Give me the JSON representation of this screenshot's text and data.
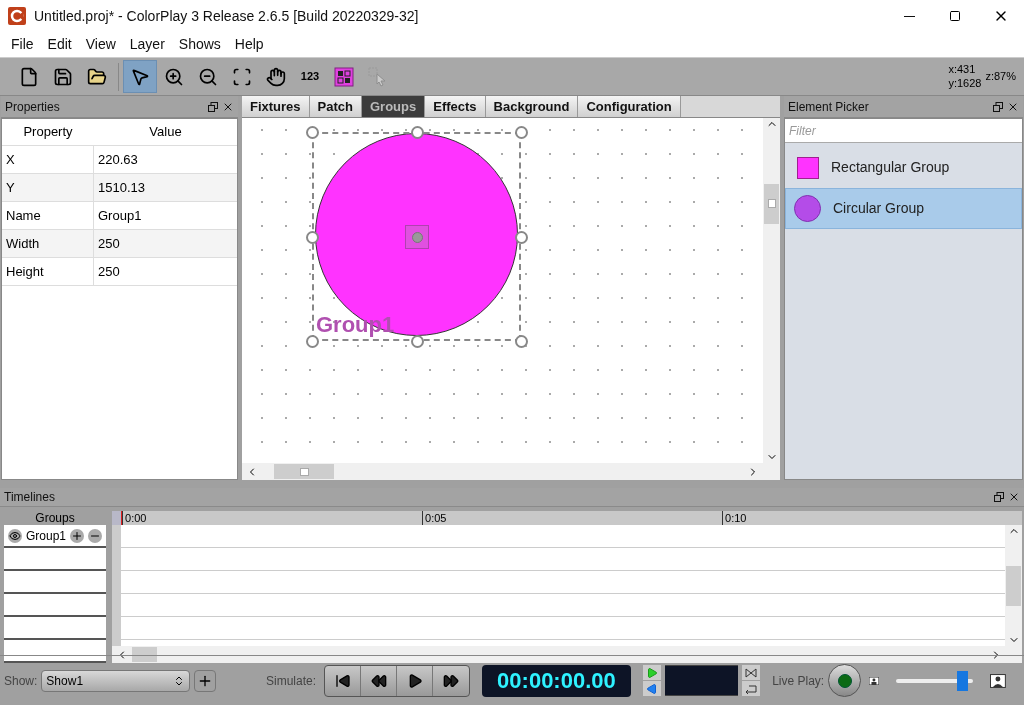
{
  "window": {
    "title": "Untitled.proj* - ColorPlay 3 Release 2.6.5 [Build 20220329-32]"
  },
  "menu": [
    "File",
    "Edit",
    "View",
    "Layer",
    "Shows",
    "Help"
  ],
  "toolbar": {
    "tools": [
      {
        "kind": "new",
        "selected": false
      },
      {
        "kind": "save",
        "selected": false
      },
      {
        "kind": "open",
        "selected": false
      },
      {
        "kind": "pointer",
        "selected": true
      },
      {
        "kind": "zoom-in",
        "selected": false
      },
      {
        "kind": "zoom-out",
        "selected": false
      },
      {
        "kind": "fit",
        "selected": false
      },
      {
        "kind": "hand",
        "selected": false
      },
      {
        "kind": "number",
        "label": "123",
        "selected": false
      },
      {
        "kind": "grid",
        "selected": false
      },
      {
        "kind": "select-area",
        "selected": false,
        "disabled": true
      }
    ],
    "x": "x:431",
    "y": "y:1628",
    "zoom": "z:87%"
  },
  "properties": {
    "title": "Properties",
    "columns": [
      "Property",
      "Value"
    ],
    "rows": [
      {
        "property": "X",
        "value": "220.63"
      },
      {
        "property": "Y",
        "value": "1510.13"
      },
      {
        "property": "Name",
        "value": "Group1"
      },
      {
        "property": "Width",
        "value": "250"
      },
      {
        "property": "Height",
        "value": "250"
      }
    ]
  },
  "tabs": [
    {
      "label": "Fixtures",
      "selected": false
    },
    {
      "label": "Patch",
      "selected": false
    },
    {
      "label": "Groups",
      "selected": true
    },
    {
      "label": "Effects",
      "selected": false
    },
    {
      "label": "Background",
      "selected": false
    },
    {
      "label": "Configuration",
      "selected": false
    }
  ],
  "canvas": {
    "group_label": "Group1"
  },
  "element_picker": {
    "title": "Element Picker",
    "filter_placeholder": "Filter",
    "items": [
      {
        "label": "Rectangular Group",
        "kind": "square",
        "selected": false
      },
      {
        "label": "Circular Group",
        "kind": "circle",
        "selected": true
      }
    ]
  },
  "timelines": {
    "title": "Timelines",
    "groups_header": "Groups",
    "groups": [
      {
        "name": "Group1"
      }
    ],
    "ticks": [
      "0:00",
      "0:05",
      "0:10"
    ]
  },
  "bottom": {
    "show_label": "Show:",
    "show_value": "Show1",
    "simulate_label": "Simulate:",
    "time": "00:00:00.00",
    "live_play_label": "Live Play:",
    "zoom": {
      "level": 0.85
    }
  }
}
